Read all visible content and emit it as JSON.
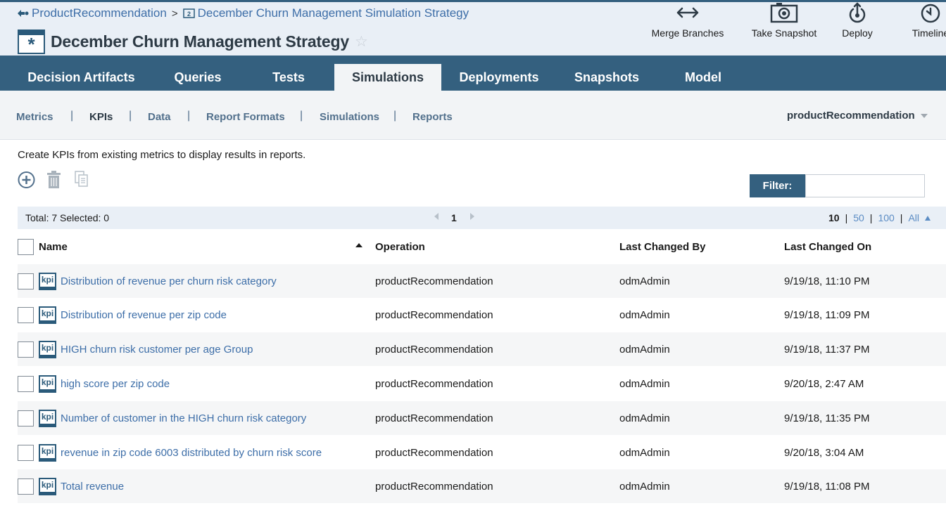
{
  "breadcrumb": {
    "project": "ProductRecommendation",
    "separator": ">",
    "branch": "December Churn Management Simulation Strategy"
  },
  "title": "December Churn Management Strategy",
  "header_actions": {
    "merge": "Merge Branches",
    "snapshot": "Take Snapshot",
    "deploy": "Deploy",
    "timeline": "Timeline"
  },
  "tabs": [
    "Decision Artifacts",
    "Queries",
    "Tests",
    "Simulations",
    "Deployments",
    "Snapshots",
    "Model"
  ],
  "active_tab": "Simulations",
  "subtabs": [
    "Metrics",
    "KPIs",
    "Data",
    "Report Formats",
    "Simulations",
    "Reports"
  ],
  "subtab_separator": "|",
  "active_subtab": "KPIs",
  "project_selector": "productRecommendation",
  "description": "Create KPIs from existing metrics to display results in reports.",
  "toolbar": {
    "add_icon": "add-circle-icon",
    "delete_icon": "trash-icon",
    "copy_icon": "copy-icon"
  },
  "filter": {
    "label": "Filter:",
    "value": ""
  },
  "pager": {
    "totals": "Total: 7 Selected: 0",
    "current_page": "1",
    "page_sizes": [
      "10",
      "50",
      "100",
      "All"
    ],
    "current_page_size": "10"
  },
  "table": {
    "columns": [
      "Name",
      "Operation",
      "Last Changed By",
      "Last Changed On"
    ],
    "kpi_badge": "kpi",
    "rows": [
      {
        "name": "Distribution of revenue per churn risk category",
        "operation": "productRecommendation",
        "by": "odmAdmin",
        "on": "9/19/18, 11:10 PM"
      },
      {
        "name": "Distribution of revenue per zip code",
        "operation": "productRecommendation",
        "by": "odmAdmin",
        "on": "9/19/18, 11:09 PM"
      },
      {
        "name": "HIGH churn risk customer per age Group",
        "operation": "productRecommendation",
        "by": "odmAdmin",
        "on": "9/19/18, 11:37 PM"
      },
      {
        "name": "high score per zip code",
        "operation": "productRecommendation",
        "by": "odmAdmin",
        "on": "9/20/18, 2:47 AM"
      },
      {
        "name": "Number of customer in the HIGH churn risk category",
        "operation": "productRecommendation",
        "by": "odmAdmin",
        "on": "9/19/18, 11:35 PM"
      },
      {
        "name": "revenue in zip code 6003 distributed by churn risk score",
        "operation": "productRecommendation",
        "by": "odmAdmin",
        "on": "9/20/18, 3:04 AM"
      },
      {
        "name": "Total revenue",
        "operation": "productRecommendation",
        "by": "odmAdmin",
        "on": "9/19/18, 11:08 PM"
      }
    ]
  },
  "colors": {
    "nav": "#34607f",
    "header": "#e9eff6",
    "link": "#3d6ea8",
    "subnav": "#f2f4f6"
  }
}
